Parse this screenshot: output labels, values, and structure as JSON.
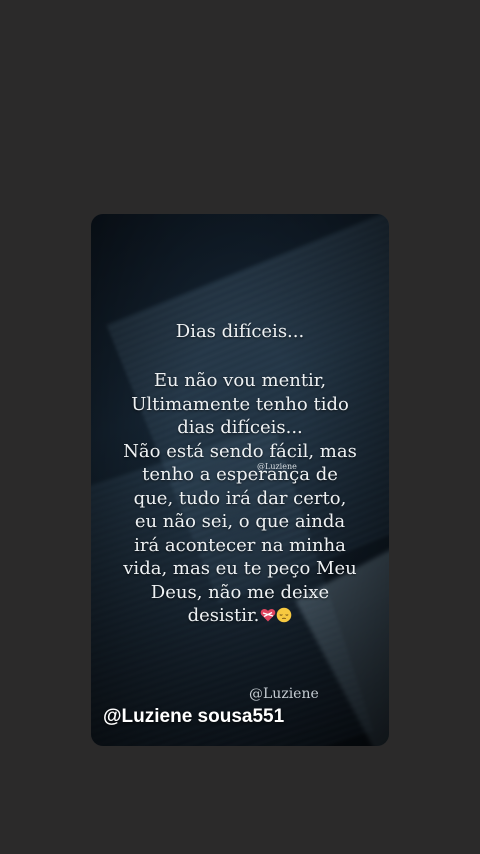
{
  "story": {
    "title": "Dias difíceis...",
    "body_lines": [
      "Eu não vou mentir,",
      "Ultimamente tenho tido",
      "dias difíceis...",
      "Não está sendo fácil, mas",
      "tenho a esperança de",
      "que, tudo irá dar certo,",
      "eu não sei, o que ainda",
      "irá acontecer na minha",
      "vida, mas eu te peço Meu",
      "Deus, não me deixe",
      "desistir."
    ],
    "inline_watermark": "@Luziene",
    "bottom_watermark": "@Luziene",
    "username_overlay": "@Luziene sousa551",
    "emojis": [
      "mending-heart-icon",
      "pensive-face-icon"
    ]
  },
  "colors": {
    "background": "#2b2a2a",
    "text": "#eef1f3",
    "heart": "#e0455f",
    "face": "#f7c940"
  }
}
